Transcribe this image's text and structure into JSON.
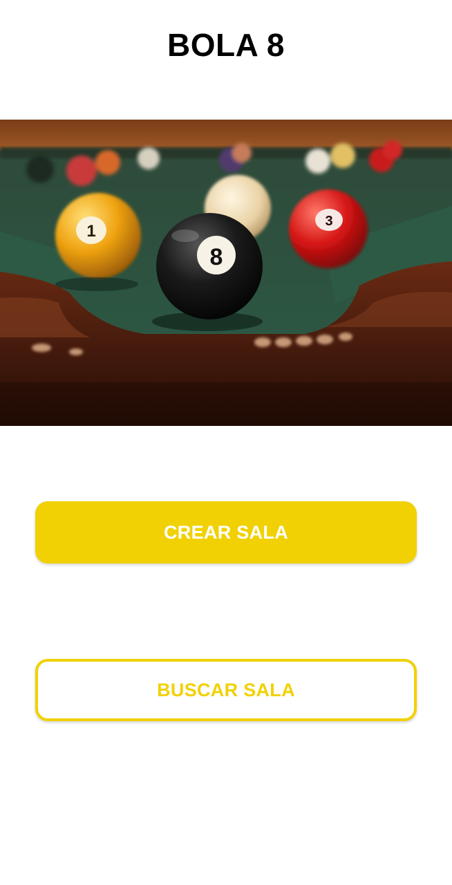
{
  "header": {
    "title": "BOLA 8"
  },
  "hero_image": {
    "description_icon": "billiard-table-photo",
    "ball_labels": [
      "1",
      "8",
      "3"
    ]
  },
  "actions": {
    "create_room_label": "CREAR SALA",
    "find_room_label": "BUSCAR SALA"
  },
  "colors": {
    "accent": "#f1d104",
    "background": "#ffffff",
    "title": "#000000"
  }
}
